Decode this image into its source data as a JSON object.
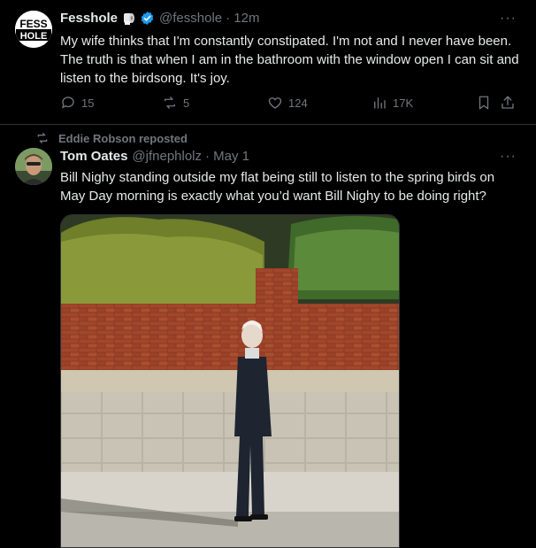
{
  "tweet1": {
    "name": "Fesshole",
    "handle": "@fesshole",
    "time": "· 12m",
    "avatar_text_top": "FESS",
    "avatar_text_bottom": "HOLE",
    "text": "My wife thinks that I'm constantly constipated. I'm not and I never have been. The truth is that when I am in the bathroom with the window open I can sit and listen to the birdsong. It's joy.",
    "replies": "15",
    "reposts": "5",
    "likes": "124",
    "views": "17K"
  },
  "tweet2": {
    "repost_label": "Eddie Robson reposted",
    "name": "Tom Oates",
    "handle": "@jfnephlolz",
    "time": "· May 1",
    "text": "Bill Nighy standing outside my flat being still to listen to the spring birds on May Day morning is exactly what you’d want Bill Nighy to be doing right?"
  },
  "icons": {
    "verified": "verified-badge-icon",
    "toilet": "toilet-paper-emoji-icon",
    "more": "more-icon",
    "reply": "reply-icon",
    "repost": "repost-icon",
    "like": "like-icon",
    "views": "views-icon",
    "bookmark": "bookmark-icon",
    "share": "share-icon"
  },
  "colors": {
    "background": "#000000",
    "text": "#e7e9ea",
    "secondary": "#71767b",
    "verified": "#1d9bf0",
    "divider": "#2f3336"
  }
}
